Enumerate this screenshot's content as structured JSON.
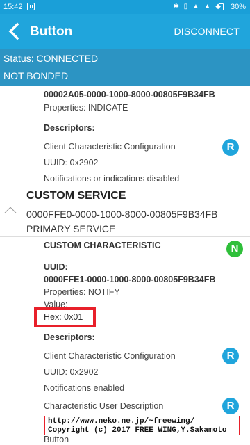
{
  "status_bar": {
    "time": "15:42",
    "system_icons": "✱ ▯ ▲ ▲ ◆",
    "battery": "30%"
  },
  "app_bar": {
    "title": "Button",
    "disconnect_label": "DISCONNECT",
    "back_icon": "back-arrow-icon"
  },
  "status_panel": {
    "status": "Status: CONNECTED",
    "bond": "NOT BONDED"
  },
  "char1": {
    "uuid": "00002A05-0000-1000-8000-00805F9B34FB",
    "properties": "Properties: INDICATE",
    "descriptors_label": "Descriptors:",
    "desc1_name": "Client Characteristic Configuration",
    "desc1_uuid": "UUID: 0x2902",
    "desc1_value": "Notifications or indications disabled",
    "desc1_badge": "R"
  },
  "service": {
    "name": "CUSTOM SERVICE",
    "uuid": "0000FFE0-0000-1000-8000-00805F9B34FB",
    "type": "PRIMARY SERVICE"
  },
  "char2": {
    "name": "CUSTOM CHARACTERISTIC",
    "badge": "N",
    "uuid_label": "UUID:",
    "uuid": "0000FFE1-0000-1000-8000-00805F9B34FB",
    "properties": "Properties: NOTIFY",
    "value_label": "Value:",
    "hex": "Hex: 0x01",
    "descriptors_label": "Descriptors:",
    "desc1_name": "Client Characteristic Configuration",
    "desc1_uuid": "UUID: 0x2902",
    "desc1_value": "Notifications enabled",
    "desc1_badge": "R",
    "desc2_name": "Characteristic User Description",
    "desc2_badge": "R",
    "desc2_value": "Button"
  },
  "footer": {
    "line1": "http://www.neko.ne.jp/~freewing/",
    "line2": "Copyright (c) 2017 FREE WING,Y.Sakamoto"
  },
  "colors": {
    "app_bar": "#20a5dc",
    "status_panel": "#2c94c3",
    "read_badge": "#20a5dc",
    "notify_badge": "#2fbf3a",
    "highlight": "#e8202a"
  }
}
